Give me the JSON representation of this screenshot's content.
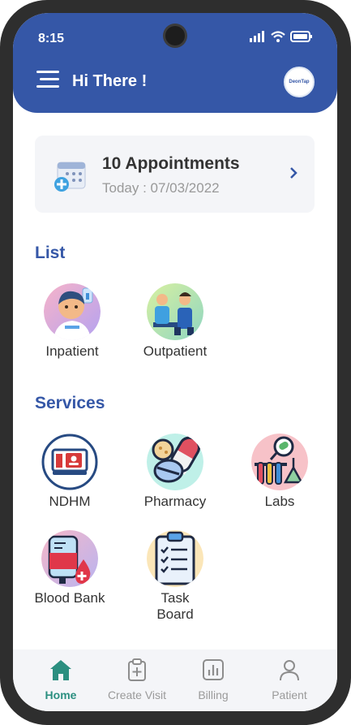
{
  "status": {
    "time": "8:15"
  },
  "header": {
    "greeting": "Hi There !",
    "avatar_text": "DeonTap"
  },
  "appointments": {
    "title": "10 Appointments",
    "subtitle": "Today : 07/03/2022"
  },
  "list": {
    "heading": "List",
    "items": [
      {
        "label": "Inpatient"
      },
      {
        "label": "Outpatient"
      }
    ]
  },
  "services": {
    "heading": "Services",
    "items": [
      {
        "label": "NDHM"
      },
      {
        "label": "Pharmacy"
      },
      {
        "label": "Labs"
      },
      {
        "label": "Blood Bank"
      },
      {
        "label": "Task Board"
      }
    ]
  },
  "nav": {
    "items": [
      {
        "label": "Home"
      },
      {
        "label": "Create Visit"
      },
      {
        "label": "Billing"
      },
      {
        "label": "Patient"
      }
    ]
  },
  "colors": {
    "primary": "#3557a7",
    "accent": "#2b8f80",
    "card_bg": "#f4f5f8"
  }
}
